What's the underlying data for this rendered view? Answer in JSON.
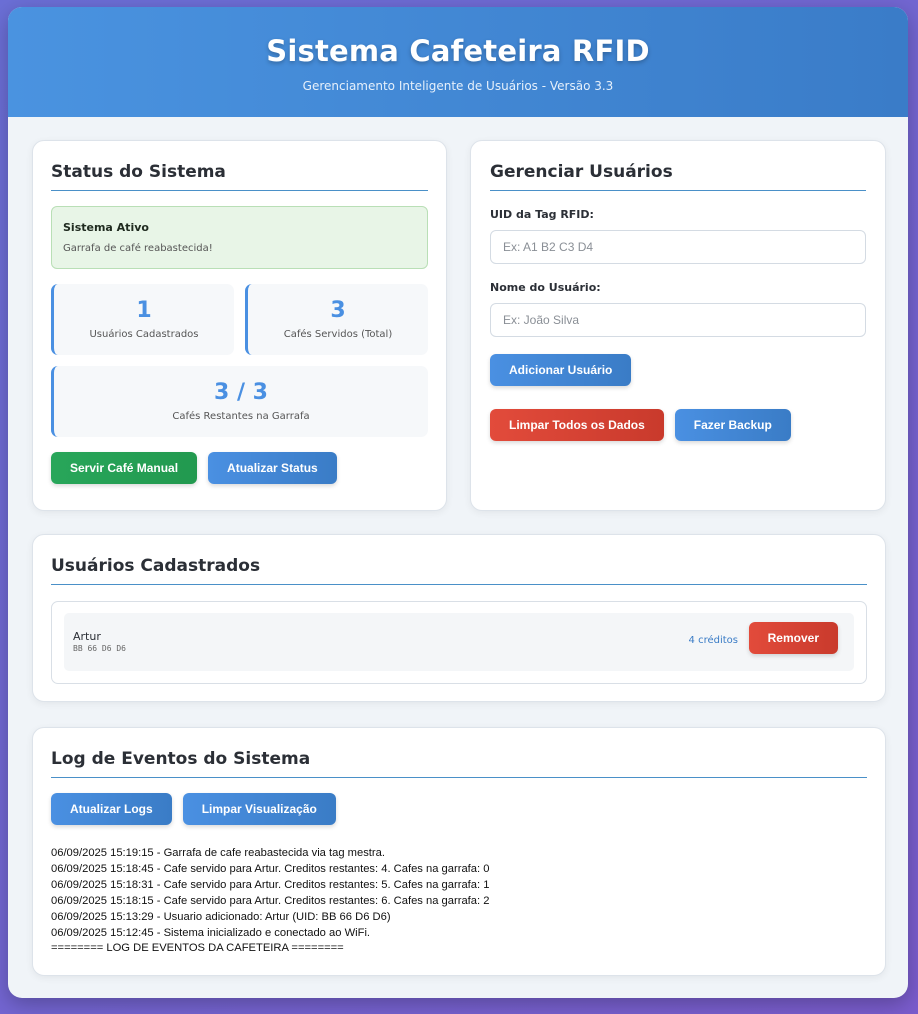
{
  "header": {
    "title": "Sistema Cafeteira RFID",
    "subtitle": "Gerenciamento Inteligente de Usuários - Versão 3.3"
  },
  "status": {
    "title": "Status do Sistema",
    "alert_title": "Sistema Ativo",
    "alert_message": "Garrafa de café reabastecida!",
    "stats": [
      {
        "value": "1",
        "label": "Usuários Cadastrados"
      },
      {
        "value": "3",
        "label": "Cafés Servidos (Total)"
      },
      {
        "value": "3 / 3",
        "label": "Cafés Restantes na Garrafa"
      }
    ],
    "serve_button": "Servir Café Manual",
    "refresh_button": "Atualizar Status"
  },
  "manage": {
    "title": "Gerenciar Usuários",
    "uid_label": "UID da Tag RFID:",
    "uid_placeholder": "Ex: A1 B2 C3 D4",
    "name_label": "Nome do Usuário:",
    "name_placeholder": "Ex: João Silva",
    "add_button": "Adicionar Usuário",
    "clear_button": "Limpar Todos os Dados",
    "backup_button": "Fazer Backup"
  },
  "users": {
    "title": "Usuários Cadastrados",
    "list": [
      {
        "name": "Artur",
        "uid": "BB 66 D6 D6",
        "credits": "4 créditos",
        "remove": "Remover"
      }
    ]
  },
  "log": {
    "title": "Log de Eventos do Sistema",
    "refresh_button": "Atualizar Logs",
    "clear_button": "Limpar Visualização",
    "lines": [
      "06/09/2025 15:19:15 - Garrafa de cafe reabastecida via tag mestra.",
      "06/09/2025 15:18:45 - Cafe servido para Artur. Creditos restantes: 4. Cafes na garrafa: 0",
      "06/09/2025 15:18:31 - Cafe servido para Artur. Creditos restantes: 5. Cafes na garrafa: 1",
      "06/09/2025 15:18:15 - Cafe servido para Artur. Creditos restantes: 6. Cafes na garrafa: 2",
      "06/09/2025 15:13:29 - Usuario adicionado: Artur (UID: BB 66 D6 D6)",
      "06/09/2025 15:12:45 - Sistema inicializado e conectado ao WiFi.",
      "======== LOG DE EVENTOS DA CAFETEIRA ========"
    ]
  }
}
